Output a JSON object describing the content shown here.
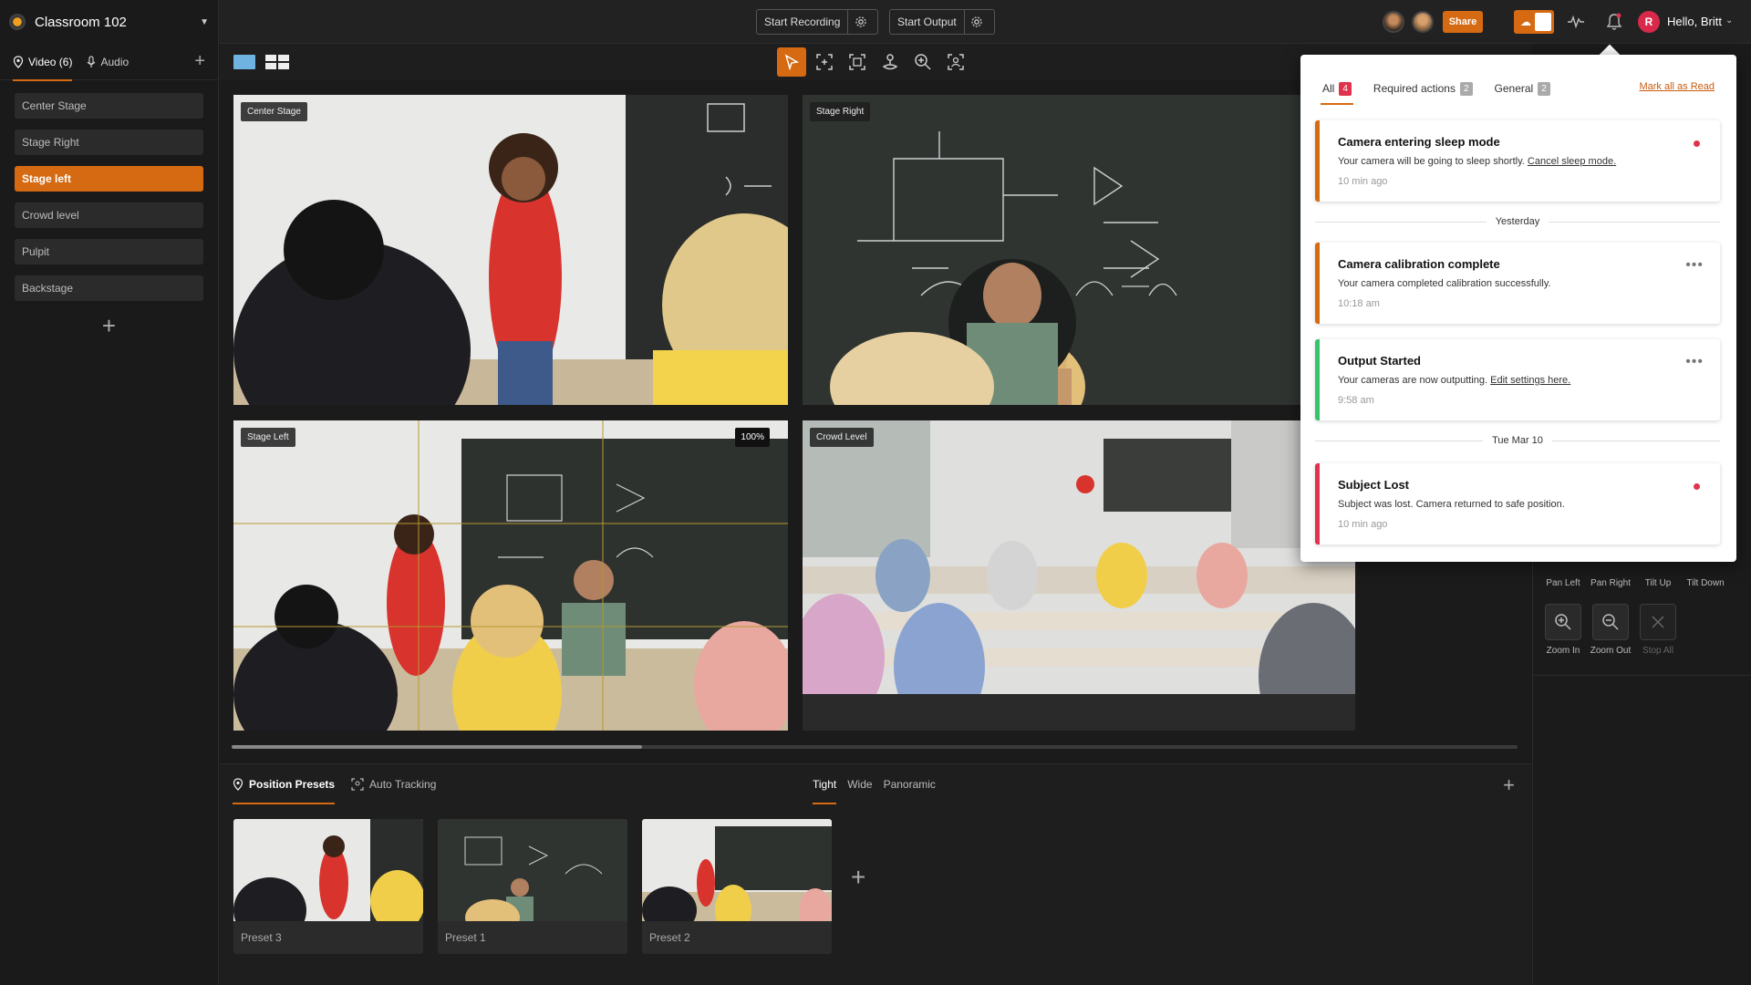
{
  "room": {
    "title": "Classroom 102"
  },
  "topbar": {
    "start_recording": "Start Recording",
    "start_output": "Start Output",
    "share": "Share",
    "user_initial": "R",
    "greeting": "Hello, Britt"
  },
  "sidebar": {
    "tabs": [
      {
        "label": "Video (6)"
      },
      {
        "label": "Audio"
      }
    ],
    "cameras": [
      {
        "label": "Center Stage"
      },
      {
        "label": "Stage Right"
      },
      {
        "label": "Stage left"
      },
      {
        "label": "Crowd level"
      },
      {
        "label": "Pulpit"
      },
      {
        "label": "Backstage"
      }
    ]
  },
  "feeds": [
    {
      "label": "Center Stage"
    },
    {
      "label": "Stage Right"
    },
    {
      "label": "Stage Left",
      "zoom": "100%"
    },
    {
      "label": "Crowd Level"
    }
  ],
  "controls": {
    "pan_left": "Pan Left",
    "pan_right": "Pan Right",
    "tilt_up": "Tilt Up",
    "tilt_down": "Tilt Down",
    "zoom_in": "Zoom In",
    "zoom_out": "Zoom Out",
    "stop_all": "Stop All"
  },
  "bottom": {
    "tabs": [
      {
        "label": "Position Presets"
      },
      {
        "label": "Auto Tracking"
      }
    ],
    "framing": [
      {
        "label": "Tight"
      },
      {
        "label": "Wide"
      },
      {
        "label": "Panoramic"
      }
    ],
    "presets": [
      {
        "label": "Preset 3"
      },
      {
        "label": "Preset 1"
      },
      {
        "label": "Preset 2"
      }
    ]
  },
  "notifications": {
    "tabs": [
      {
        "label": "All",
        "count": "4"
      },
      {
        "label": "Required actions",
        "count": "2"
      },
      {
        "label": "General",
        "count": "2"
      }
    ],
    "mark_all": "Mark all as Read",
    "groups": [
      {
        "label": "Yesterday"
      },
      {
        "label": "Tue Mar 10"
      }
    ],
    "items": [
      {
        "title": "Camera entering sleep mode",
        "body": "Your camera will be going to sleep shortly.",
        "link": "Cancel sleep mode.",
        "time": "10 min ago"
      },
      {
        "title": "Camera calibration complete",
        "body": "Your camera completed calibration successfully.",
        "link": "",
        "time": "10:18 am"
      },
      {
        "title": "Output Started",
        "body": "Your cameras are now outputting.",
        "link": "Edit settings here.",
        "time": "9:58 am"
      },
      {
        "title": "Subject Lost",
        "body": "Subject was lost. Camera returned to safe position.",
        "link": "",
        "time": "10 min ago"
      }
    ]
  },
  "colors": {
    "accent": "#d56a12",
    "danger": "#e0334d",
    "success": "#34c470"
  }
}
